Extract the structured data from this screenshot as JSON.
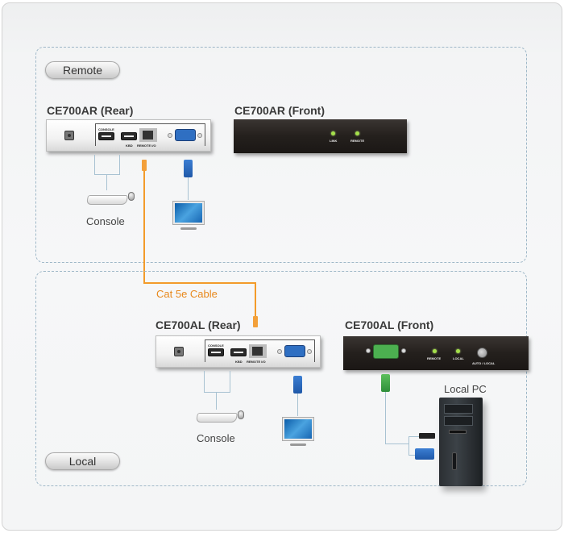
{
  "zones": {
    "remote": {
      "label": "Remote"
    },
    "local": {
      "label": "Local"
    }
  },
  "devices": {
    "remote_rear": {
      "title": "CE700AR (Rear)",
      "port_labels": {
        "console": "CONSOLE",
        "remote_io": "REMOTE I/O",
        "usb_kbd": "KBD"
      }
    },
    "remote_front": {
      "title": "CE700AR (Front)",
      "leds": [
        {
          "label": "LINK",
          "color": "#a4e04a"
        },
        {
          "label": "REMOTE",
          "color": "#a4e04a"
        }
      ]
    },
    "local_rear": {
      "title": "CE700AL (Rear)",
      "port_labels": {
        "console": "CONSOLE",
        "remote_io": "REMOTE I/O",
        "usb_kbd": "KBD"
      }
    },
    "local_front": {
      "title": "CE700AL (Front)",
      "leds": [
        {
          "label": "REMOTE",
          "color": "#a4e04a"
        },
        {
          "label": "LOCAL",
          "color": "#a4e04a"
        }
      ],
      "button_label": "AUTO / LOCAL"
    }
  },
  "labels": {
    "remote_console": "Console",
    "local_console": "Console",
    "local_pc": "Local PC",
    "cable": "Cat 5e Cable"
  },
  "colors": {
    "cable": "#f39b2a",
    "connector_line": "#a8c2d2",
    "zone_border": "#9fb8c8",
    "cable_label": "#e8891d"
  }
}
